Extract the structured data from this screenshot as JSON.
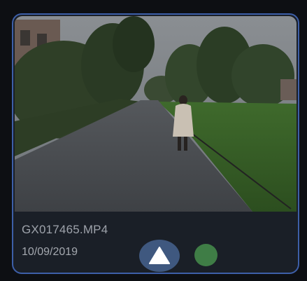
{
  "video_card": {
    "filename": "GX017465.MP4",
    "date": "10/09/2019",
    "thumbnail_icon": "video-thumbnail",
    "upload_icon": "triangle-up-icon",
    "status_icon": "status-dot",
    "status_color": "#3f7d46",
    "accent_color": "#3d5fa8"
  }
}
